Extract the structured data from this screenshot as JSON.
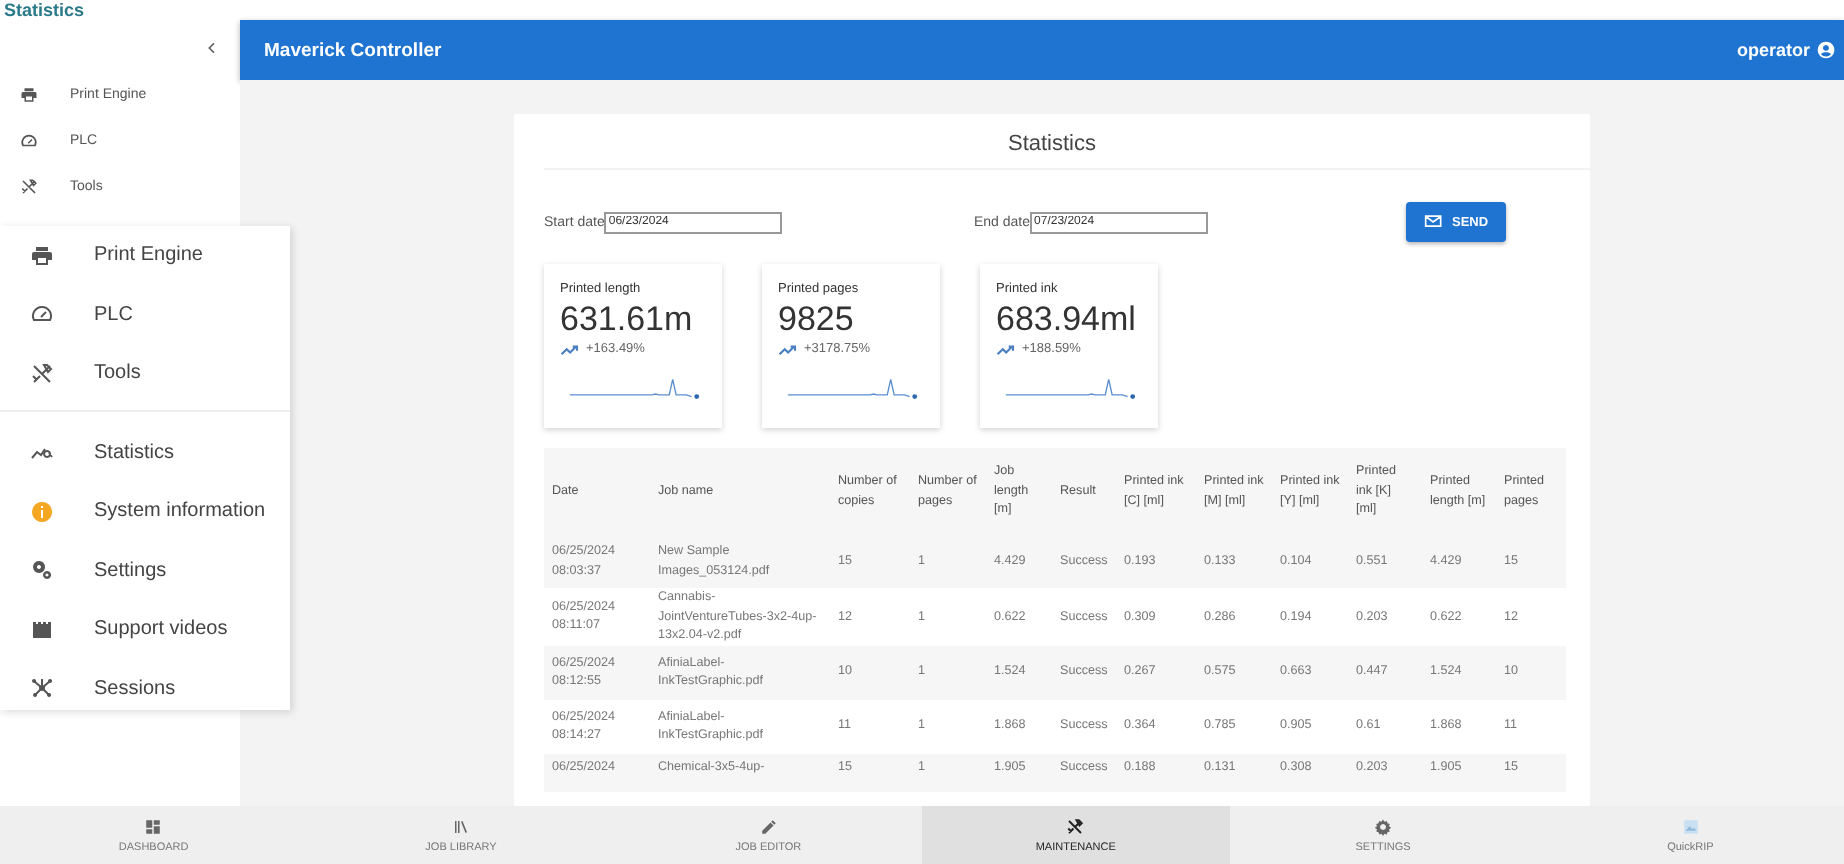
{
  "page_title": "Statistics",
  "sidebar": {
    "items": [
      {
        "label": "Print Engine"
      },
      {
        "label": "PLC"
      },
      {
        "label": "Tools"
      }
    ]
  },
  "menu": {
    "groups": [
      [
        {
          "label": "Print Engine"
        },
        {
          "label": "PLC"
        },
        {
          "label": "Tools"
        }
      ],
      [
        {
          "label": "Statistics"
        },
        {
          "label": "System information"
        },
        {
          "label": "Settings"
        },
        {
          "label": "Support videos"
        },
        {
          "label": "Sessions"
        }
      ]
    ]
  },
  "topbar": {
    "title": "Maverick Controller",
    "user": "operator"
  },
  "stats": {
    "title": "Statistics",
    "start_label": "Start date",
    "start": "06/23/2024",
    "end_label": "End date",
    "end": "07/23/2024",
    "send": "SEND",
    "cards": [
      {
        "label": "Printed length",
        "value": "631.61m",
        "change": "+163.49%"
      },
      {
        "label": "Printed pages",
        "value": "9825",
        "change": "+3178.75%"
      },
      {
        "label": "Printed ink",
        "value": "683.94ml",
        "change": "+188.59%"
      }
    ],
    "table": {
      "columns": [
        "Date",
        "Job name",
        "Number of copies",
        "Number of pages",
        "Job length [m]",
        "Result",
        "Printed ink [C] [ml]",
        "Printed ink [M] [ml]",
        "Printed ink [Y] [ml]",
        "Printed ink [K] [ml]",
        "Printed length [m]",
        "Printed pages"
      ],
      "rows": [
        [
          "06/25/2024 08:03:37",
          "New Sample Images_053124.pdf",
          "15",
          "1",
          "4.429",
          "Success",
          "0.193",
          "0.133",
          "0.104",
          "0.551",
          "4.429",
          "15"
        ],
        [
          "06/25/2024 08:11:07",
          "Cannabis-JointVentureTubes-3x2-4up-13x2.04-v2.pdf",
          "12",
          "1",
          "0.622",
          "Success",
          "0.309",
          "0.286",
          "0.194",
          "0.203",
          "0.622",
          "12"
        ],
        [
          "06/25/2024 08:12:55",
          "AfiniaLabel-InkTestGraphic.pdf",
          "10",
          "1",
          "1.524",
          "Success",
          "0.267",
          "0.575",
          "0.663",
          "0.447",
          "1.524",
          "10"
        ],
        [
          "06/25/2024 08:14:27",
          "AfiniaLabel-InkTestGraphic.pdf",
          "11",
          "1",
          "1.868",
          "Success",
          "0.364",
          "0.785",
          "0.905",
          "0.61",
          "1.868",
          "11"
        ],
        [
          "06/25/2024",
          "Chemical-3x5-4up-",
          "15",
          "1",
          "1.905",
          "Success",
          "0.188",
          "0.131",
          "0.308",
          "0.203",
          "1.905",
          "15"
        ]
      ]
    }
  },
  "bottom_nav": [
    {
      "label": "DASHBOARD",
      "selected": false
    },
    {
      "label": "JOB LIBRARY",
      "selected": false
    },
    {
      "label": "JOB EDITOR",
      "selected": false
    },
    {
      "label": "MAINTENANCE",
      "selected": true
    },
    {
      "label": "SETTINGS",
      "selected": false
    },
    {
      "label": "QuickRIP",
      "selected": false
    }
  ]
}
